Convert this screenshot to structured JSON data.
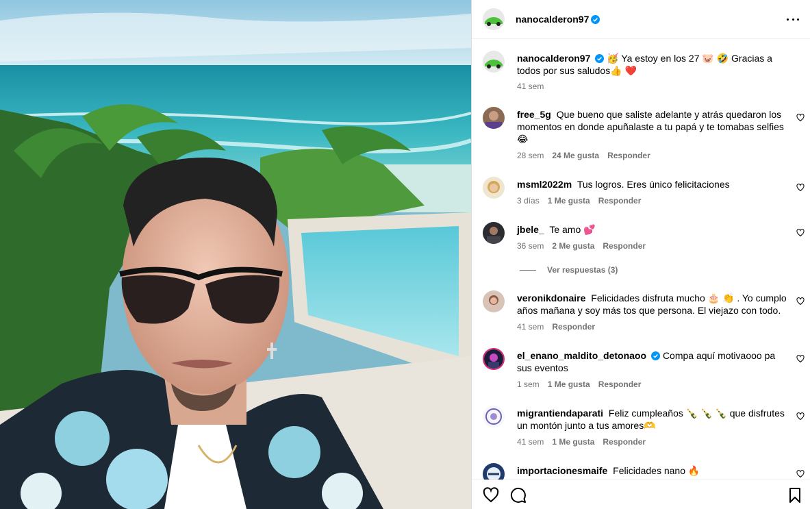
{
  "post": {
    "username": "nanocalderon97",
    "caption": "🥳 Ya estoy en los 27 🐷 🤣  Gracias a todos por sus saludos👍 ❤️",
    "caption_time": "41 sem"
  },
  "comments": [
    {
      "user": "free_5g",
      "text": "Que bueno que saliste adelante y atrás quedaron los momentos en donde apuñalaste a tu papá y te tomabas selfies 😂",
      "time": "28 sem",
      "likes": "24 Me gusta",
      "reply": "Responder"
    },
    {
      "user": "msml2022m",
      "text": "Tus logros. Eres único felicitaciones",
      "time": "3 días",
      "likes": "1 Me gusta",
      "reply": "Responder"
    },
    {
      "user": "jbele_",
      "text": "Te amo 💕",
      "time": "36 sem",
      "likes": "2 Me gusta",
      "reply": "Responder",
      "view_replies": "Ver respuestas (3)"
    },
    {
      "user": "veronikdonaire",
      "text": "Felicidades disfruta mucho 🎂 👏 . Yo cumplo años mañana y soy más tos que persona. El viejazo con todo.",
      "time": "41 sem",
      "likes": "",
      "reply": "Responder"
    },
    {
      "user": "el_enano_maldito_detonaoo",
      "text": "Compa aquí motivaooo pa sus eventos",
      "time": "1 sem",
      "likes": "1 Me gusta",
      "reply": "Responder"
    },
    {
      "user": "migrantiendaparati",
      "text": "Feliz cumpleaños 🍾 🍾 🍾 que disfrutes un montón junto a tus amores🫶",
      "time": "41 sem",
      "likes": "1 Me gusta",
      "reply": "Responder"
    },
    {
      "user": "importacionesmaife",
      "text": "Felicidades nano 🔥",
      "time": "",
      "likes": "",
      "reply": ""
    }
  ],
  "icons": {
    "like": "heart-icon",
    "comment": "comment-icon",
    "save": "bookmark-icon",
    "more": "more-options-icon",
    "verified": "verified-badge-icon"
  },
  "colors": {
    "verified": "#0095f6",
    "meta": "#737373",
    "border": "#dbdbdb"
  }
}
